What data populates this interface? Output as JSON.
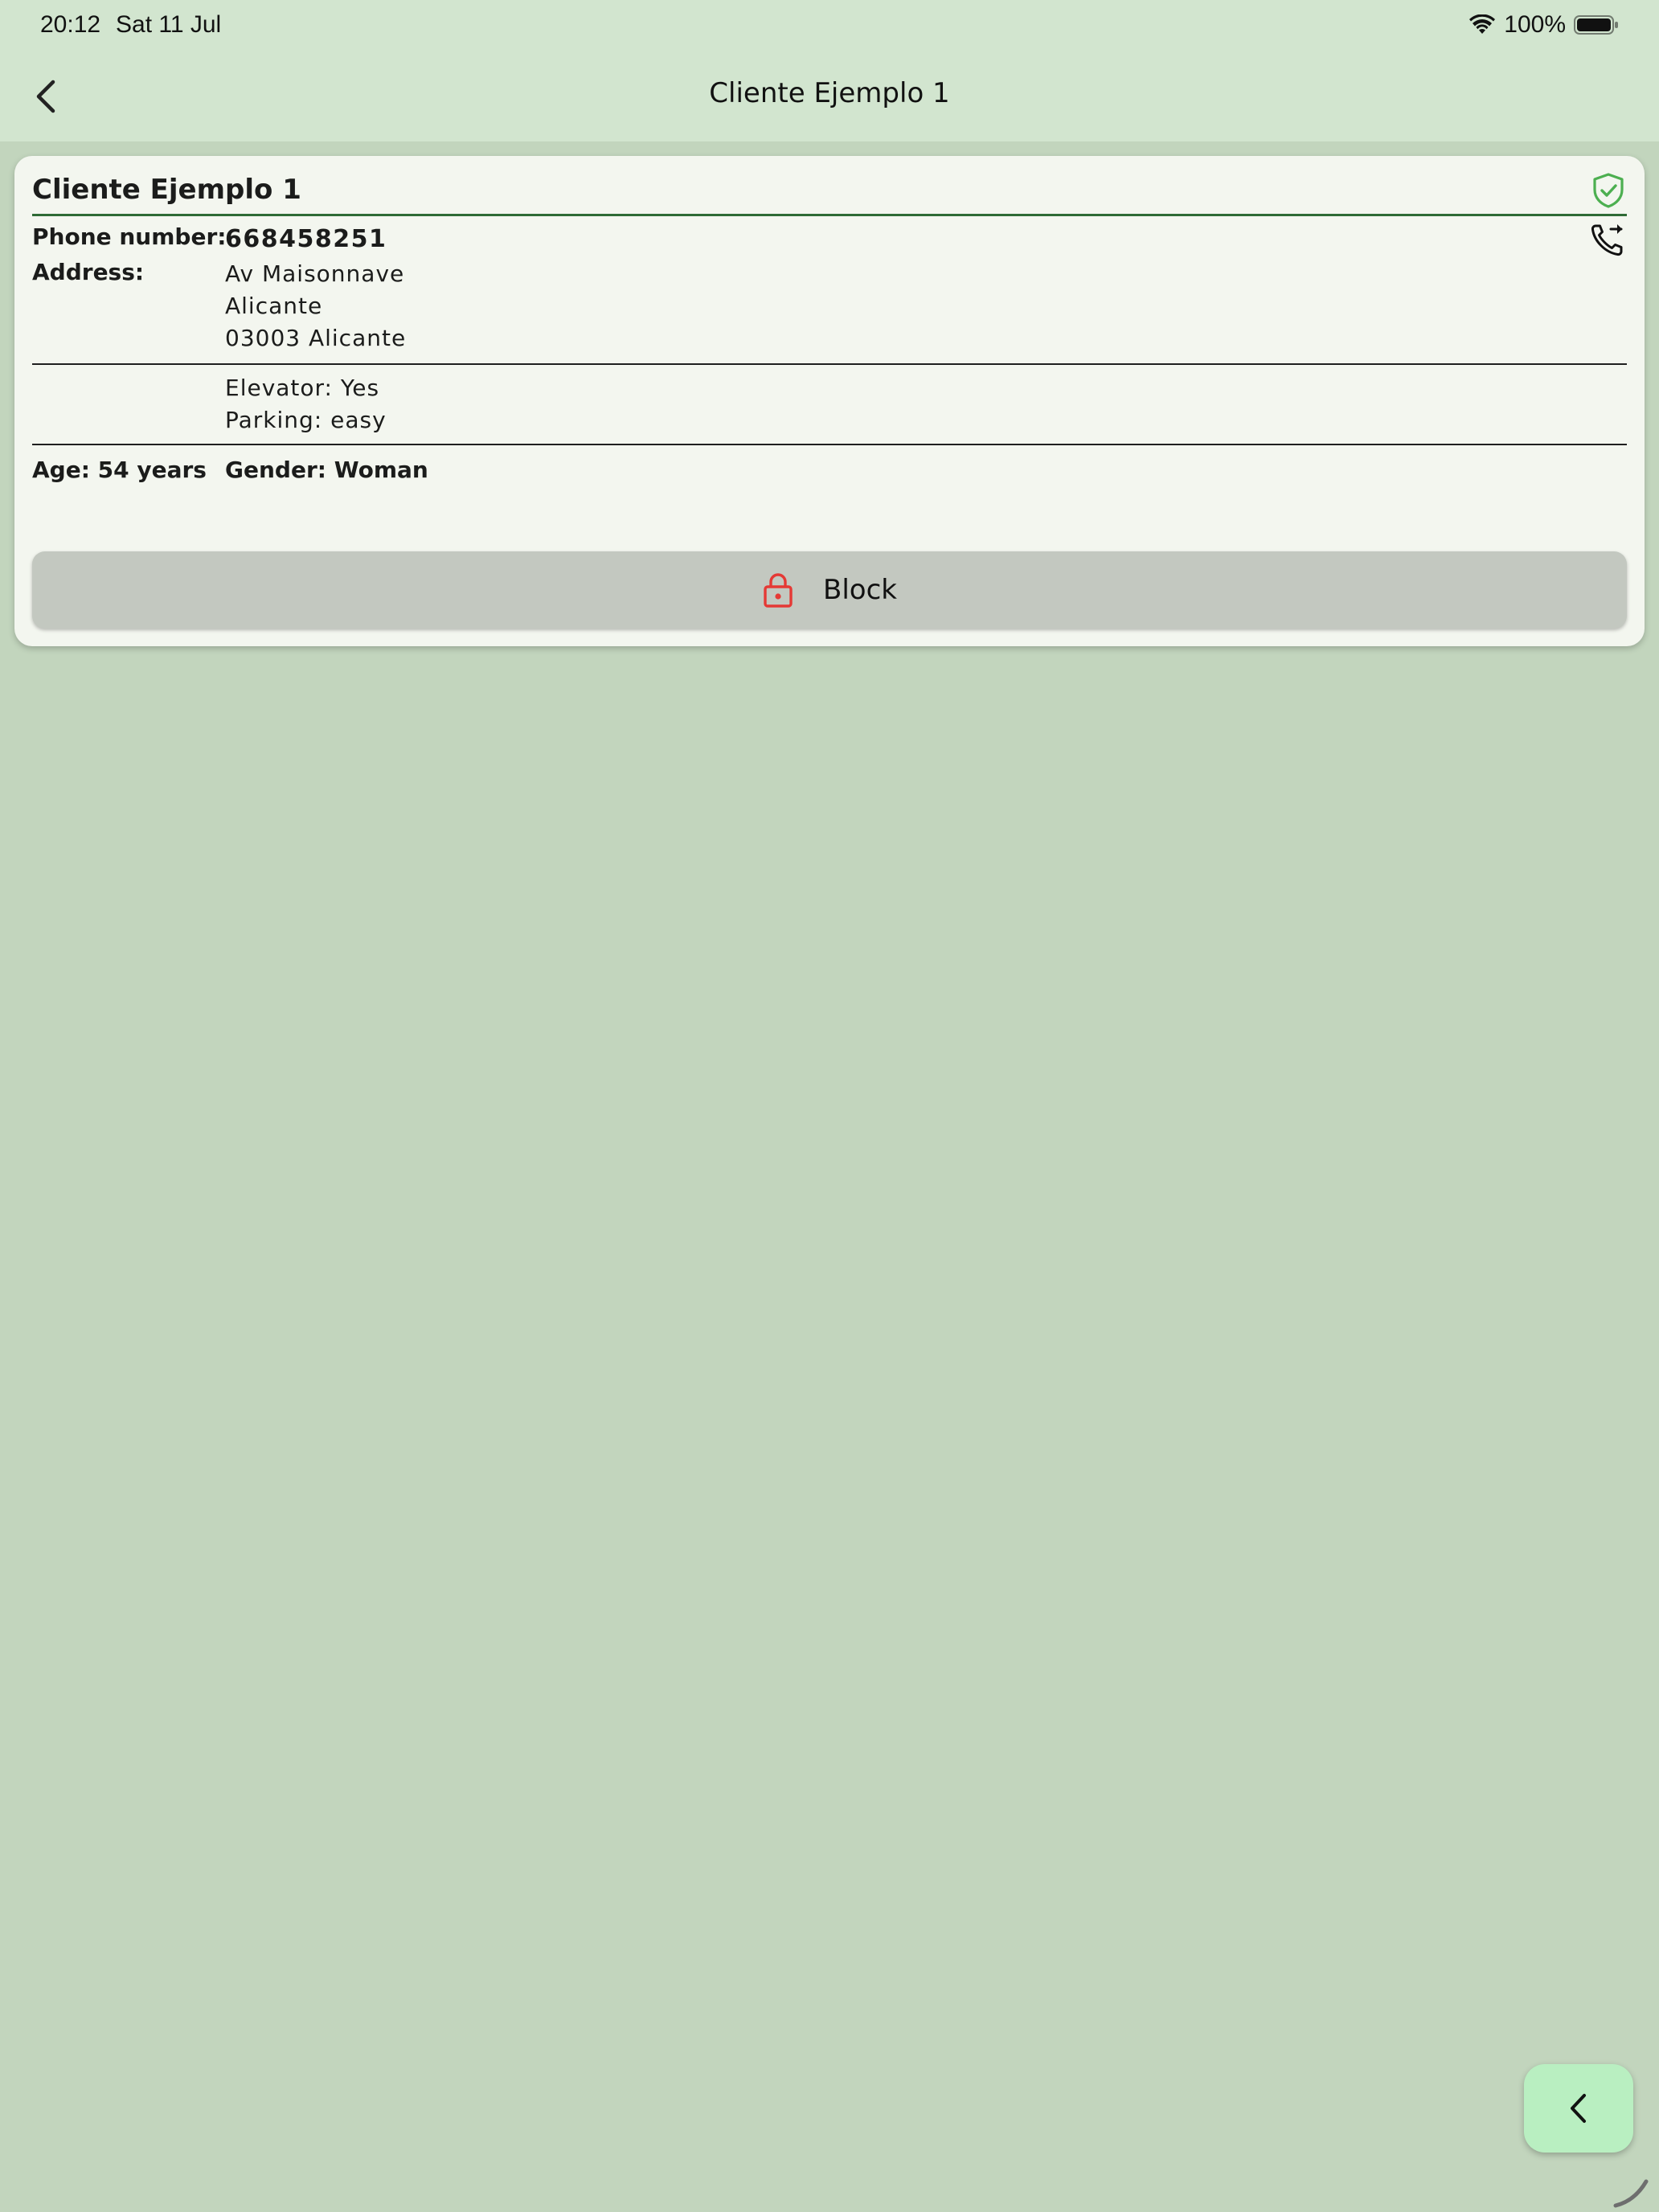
{
  "status_bar": {
    "time": "20:12",
    "date": "Sat 11 Jul",
    "battery_text": "100%"
  },
  "app_bar": {
    "title": "Cliente Ejemplo 1",
    "back_icon": "chevron-left-icon"
  },
  "client": {
    "name": "Cliente Ejemplo 1",
    "verified_icon": "shield-check-icon",
    "phone_label": "Phone number:",
    "phone_value": "668458251",
    "call_icon": "phone-forward-icon",
    "address_label": "Address:",
    "address_lines": [
      "Av Maisonnave",
      "Alicante",
      "03003 Alicante"
    ],
    "elevator": "Elevator: Yes",
    "parking": "Parking: easy",
    "age": "Age: 54 years",
    "gender": "Gender: Woman"
  },
  "actions": {
    "block_label": "Block",
    "block_icon": "lock-icon"
  },
  "fab": {
    "icon": "chevron-left-icon"
  },
  "colors": {
    "background": "#c2d5bd",
    "app_bar": "#d2e5cf",
    "card": "#f3f6ef",
    "accent_green": "#2e6a35",
    "verified_green": "#4caf50",
    "lock_red": "#e53935",
    "fab": "#b9efc1"
  }
}
